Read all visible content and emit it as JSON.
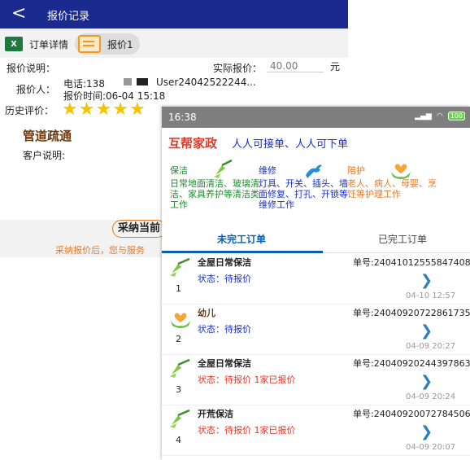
{
  "back_screen": {
    "title": "报价记录",
    "tabs": [
      {
        "label": "订单详情",
        "icon": "excel-icon"
      },
      {
        "label": "报价1",
        "icon": "quote-icon"
      }
    ],
    "form": {
      "desc_label": "报价说明：",
      "actual_price_label": "实际报价：",
      "actual_price_value": "40.00",
      "currency": "元",
      "quoter_label": "报价人：",
      "phone": "电话:138",
      "user": "User24042522244...",
      "quote_time": "报价时间:06-04 15:18",
      "history_label": "历史评价："
    },
    "rating": 5,
    "content_title": "管道疏通",
    "customer_label": "客户说明:",
    "accept_button": "采纳当前",
    "note": "采纳报价后，您与服务"
  },
  "front_screen": {
    "time": "16:38",
    "battery": "100",
    "brand": "互帮家政",
    "slogan": "人人可接单、人人可下单",
    "services": [
      {
        "name": "保洁",
        "desc": "日常地面清洁、玻璃清洁、家具养护等清洁类工作",
        "icon": "broom-icon",
        "color": "#1f8a2e"
      },
      {
        "name": "维修",
        "desc": "灯具、开关、插头、墙面修复、打孔、开锁等维修工作",
        "icon": "wrench-icon",
        "color": "#1a2fbf"
      },
      {
        "name": "陪护",
        "desc": "老人、病人、母婴、烹饪等护理工作",
        "icon": "heart-hands-icon",
        "color": "#e07b2a"
      }
    ],
    "tabs": [
      "未完工订单",
      "已完工订单"
    ],
    "orders": [
      {
        "index": "1",
        "name": "全屋日常保洁",
        "no": "单号:24041012555847408",
        "status": "状态：待报价",
        "time": "04-10 12:57",
        "icon": "broom-icon"
      },
      {
        "index": "2",
        "name": "幼儿",
        "no": "单号:24040920722861735",
        "status": "状态：待报价",
        "time": "04-09 20:27",
        "icon": "heart-hands-icon"
      },
      {
        "index": "3",
        "name": "全屋日常保洁",
        "no": "单号:24040920244397863",
        "status": "状态：待报价 1家已报价",
        "time": "04-09 20:24",
        "icon": "broom-icon"
      },
      {
        "index": "4",
        "name": "开荒保洁",
        "no": "单号:24040920072784506",
        "status": "状态：待报价 1家已报价",
        "time": "04-09 20:07",
        "icon": "broom-icon"
      }
    ],
    "chevron": "❯"
  }
}
